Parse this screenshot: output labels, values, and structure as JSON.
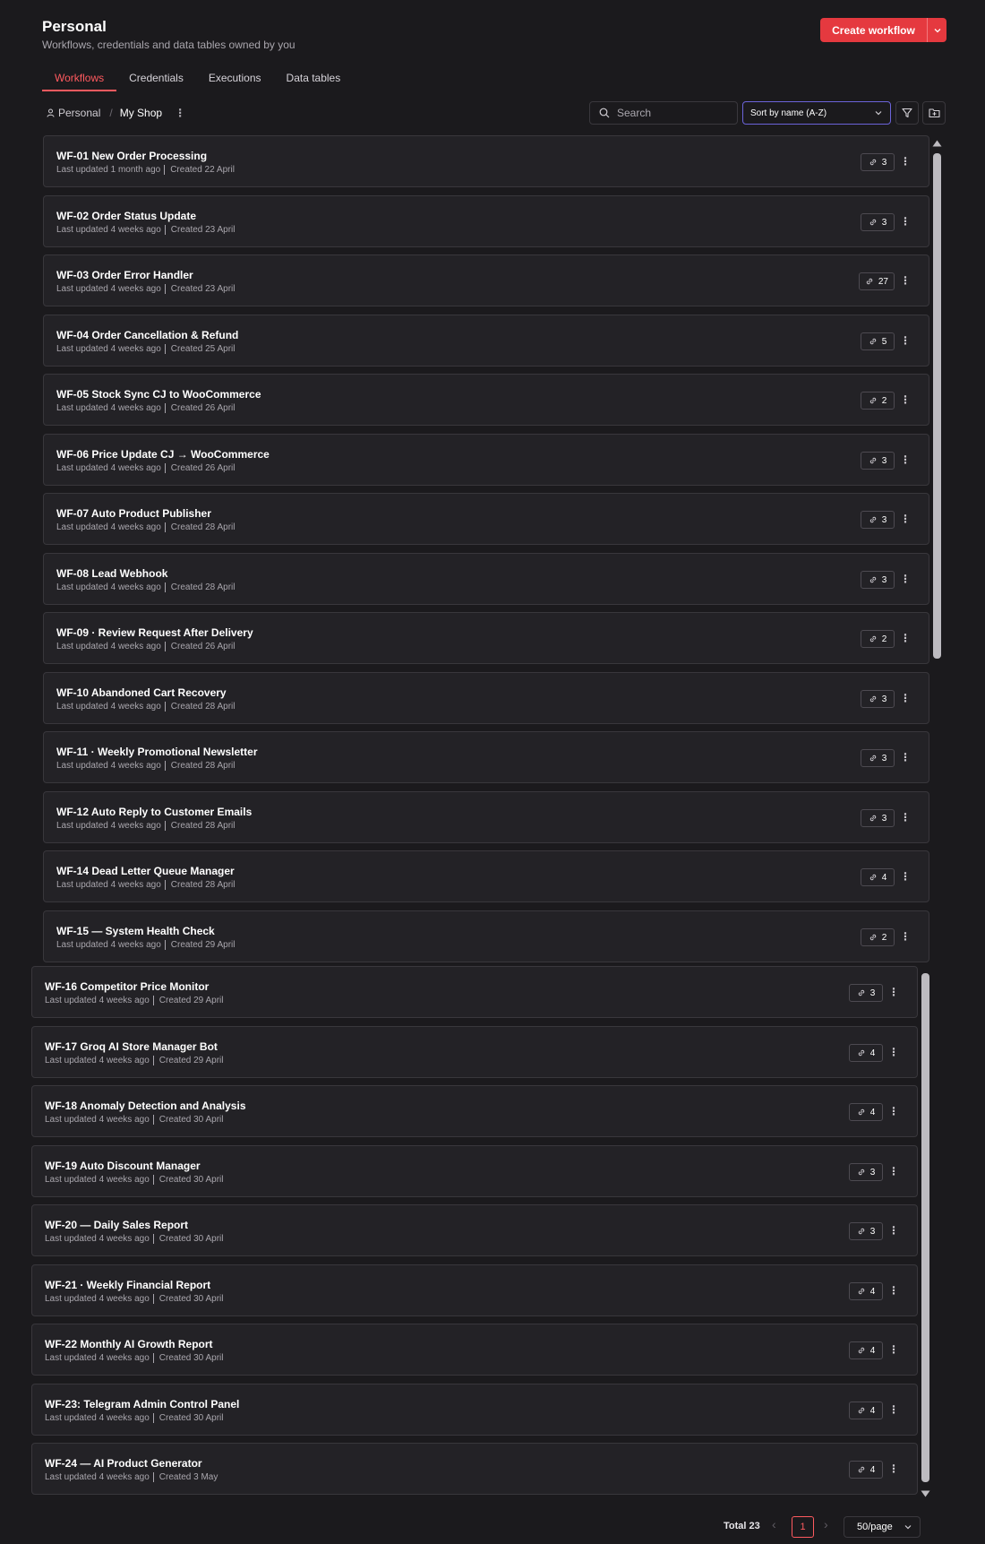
{
  "header": {
    "title": "Personal",
    "subtitle": "Workflows, credentials and data tables owned by you",
    "create_button": "Create workflow"
  },
  "tabs": [
    {
      "label": "Workflows",
      "active": true
    },
    {
      "label": "Credentials",
      "active": false
    },
    {
      "label": "Executions",
      "active": false
    },
    {
      "label": "Data tables",
      "active": false
    }
  ],
  "breadcrumb": {
    "root": "Personal",
    "current": "My Shop",
    "more": "⋮"
  },
  "search": {
    "placeholder": "Search",
    "value": ""
  },
  "sort": {
    "selected": "Sort by name (A-Z)"
  },
  "colors": {
    "accent": "#e5393f",
    "active_tab": "#ff5a5f",
    "background": "#1b1a1d",
    "card": "#232226"
  },
  "meta_prefix_updated": "Last updated",
  "meta_prefix_created": "Created",
  "workflows": [
    {
      "name": "WF-01 New Order Processing",
      "updated": "Last updated 1 month ago",
      "created": "Created 22 April",
      "count": "3"
    },
    {
      "name": "WF-02 Order Status Update",
      "updated": "Last updated 4 weeks ago",
      "created": "Created 23 April",
      "count": "3"
    },
    {
      "name": "WF-03 Order Error Handler",
      "updated": "Last updated 4 weeks ago",
      "created": "Created 23 April",
      "count": "27"
    },
    {
      "name": "WF-04 Order Cancellation & Refund",
      "updated": "Last updated 4 weeks ago",
      "created": "Created 25 April",
      "count": "5"
    },
    {
      "name": "WF-05 Stock Sync CJ to WooCommerce",
      "updated": "Last updated 4 weeks ago",
      "created": "Created 26 April",
      "count": "2"
    },
    {
      "name": "WF-06 Price Update CJ → WooCommerce",
      "updated": "Last updated 4 weeks ago",
      "created": "Created 26 April",
      "count": "3"
    },
    {
      "name": "WF-07 Auto Product Publisher",
      "updated": "Last updated 4 weeks ago",
      "created": "Created 28 April",
      "count": "3"
    },
    {
      "name": "WF-08 Lead Webhook",
      "updated": "Last updated 4 weeks ago",
      "created": "Created 28 April",
      "count": "3"
    },
    {
      "name": "WF-09 · Review Request After Delivery",
      "updated": "Last updated 4 weeks ago",
      "created": "Created 26 April",
      "count": "2"
    },
    {
      "name": "WF-10 Abandoned Cart Recovery",
      "updated": "Last updated 4 weeks ago",
      "created": "Created 28 April",
      "count": "3"
    },
    {
      "name": "WF-11 · Weekly Promotional Newsletter",
      "updated": "Last updated 4 weeks ago",
      "created": "Created 28 April",
      "count": "3"
    },
    {
      "name": "WF-12 Auto Reply to Customer Emails",
      "updated": "Last updated 4 weeks ago",
      "created": "Created 28 April",
      "count": "3"
    },
    {
      "name": "WF-14 Dead Letter Queue Manager",
      "updated": "Last updated 4 weeks ago",
      "created": "Created 28 April",
      "count": "4"
    },
    {
      "name": "WF-15 — System Health Check",
      "updated": "Last updated 4 weeks ago",
      "created": "Created 29 April",
      "count": "2"
    },
    {
      "name": "WF-16 Competitor Price Monitor",
      "updated": "Last updated 4 weeks ago",
      "created": "Created 29 April",
      "count": "3"
    },
    {
      "name": "WF-17 Groq AI Store Manager Bot",
      "updated": "Last updated 4 weeks ago",
      "created": "Created 29 April",
      "count": "4"
    },
    {
      "name": "WF-18 Anomaly Detection and Analysis",
      "updated": "Last updated 4 weeks ago",
      "created": "Created 30 April",
      "count": "4"
    },
    {
      "name": "WF-19 Auto Discount Manager",
      "updated": "Last updated 4 weeks ago",
      "created": "Created 30 April",
      "count": "3"
    },
    {
      "name": "WF-20 — Daily Sales Report",
      "updated": "Last updated 4 weeks ago",
      "created": "Created 30 April",
      "count": "3"
    },
    {
      "name": "WF-21 · Weekly Financial Report",
      "updated": "Last updated 4 weeks ago",
      "created": "Created 30 April",
      "count": "4"
    },
    {
      "name": "WF-22 Monthly AI Growth Report",
      "updated": "Last updated 4 weeks ago",
      "created": "Created 30 April",
      "count": "4"
    },
    {
      "name": "WF-23: Telegram Admin Control Panel",
      "updated": "Last updated 4 weeks ago",
      "created": "Created 30 April",
      "count": "4"
    },
    {
      "name": "WF-24 — AI Product Generator",
      "updated": "Last updated 4 weeks ago",
      "created": "Created 3 May",
      "count": "4"
    }
  ],
  "pagination": {
    "total": "Total 23",
    "current_page": "1",
    "page_size": "50/page"
  },
  "icons": {
    "link": "link-icon",
    "more": "more-vertical-icon",
    "search": "search-icon",
    "filter": "filter-icon",
    "new_folder": "folder-plus-icon",
    "user": "user-icon",
    "chevron": "chevron-down-icon"
  }
}
